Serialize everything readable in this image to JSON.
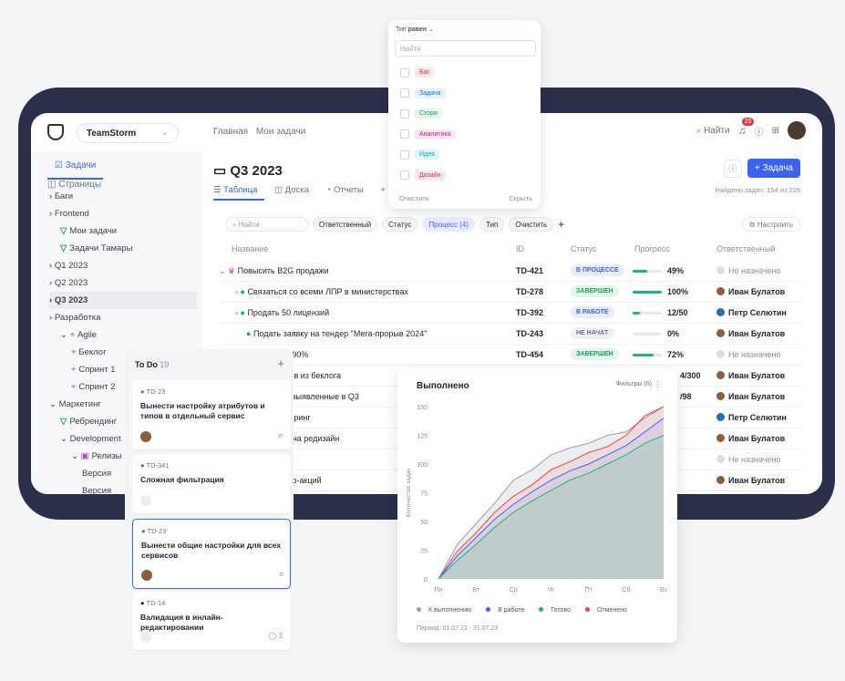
{
  "app": {
    "team": "TeamStorm",
    "nav": [
      "Главная",
      "Мои задачи"
    ],
    "search_label": "Найти",
    "notif_count": "25"
  },
  "sidebar": {
    "tabs": [
      "Задачи",
      "Страницы"
    ],
    "items": [
      {
        "label": "Баги",
        "indent": 0,
        "prefix": "›",
        "icon": ""
      },
      {
        "label": "Frontend",
        "indent": 0,
        "prefix": "›",
        "icon": ""
      },
      {
        "label": "Мои задачи",
        "indent": 1,
        "prefix": "",
        "icon": "g"
      },
      {
        "label": "Задачи Тамары",
        "indent": 1,
        "prefix": "",
        "icon": "g"
      },
      {
        "label": "Q1 2023",
        "indent": 0,
        "prefix": "›",
        "icon": ""
      },
      {
        "label": "Q2 2023",
        "indent": 0,
        "prefix": "›",
        "icon": ""
      },
      {
        "label": "Q3 2023",
        "indent": 0,
        "prefix": "›",
        "icon": "",
        "selected": true
      },
      {
        "label": "Разработка",
        "indent": 0,
        "prefix": "›",
        "icon": ""
      },
      {
        "label": "Agile",
        "indent": 1,
        "prefix": "⌄",
        "icon": "q"
      },
      {
        "label": "Беклог",
        "indent": 2,
        "prefix": "",
        "icon": "q"
      },
      {
        "label": "Спринт 1",
        "indent": 2,
        "prefix": "",
        "icon": "q"
      },
      {
        "label": "Спринт 2",
        "indent": 2,
        "prefix": "",
        "icon": "q"
      },
      {
        "label": "Маркетинг",
        "indent": 0,
        "prefix": "⌄",
        "icon": ""
      },
      {
        "label": "Ребрендинг",
        "indent": 1,
        "prefix": "",
        "icon": "g"
      },
      {
        "label": "Development",
        "indent": 1,
        "prefix": "⌄",
        "icon": ""
      },
      {
        "label": "Релизы",
        "indent": 2,
        "prefix": "⌄",
        "icon": "p"
      },
      {
        "label": "Версия",
        "indent": 3,
        "prefix": "",
        "icon": ""
      },
      {
        "label": "Версия",
        "indent": 3,
        "prefix": "",
        "icon": ""
      }
    ]
  },
  "page": {
    "title": "Q3 2023",
    "views": [
      "Таблица",
      "Доска",
      "Отчеты",
      "+"
    ],
    "add_task": "+ Задача",
    "found": "Найдено задач: 154 из 226"
  },
  "filters": {
    "search_placeholder": "Найти",
    "chips": [
      "Ответственный",
      "Статус",
      "Процесс (4)",
      "Тип"
    ],
    "clear": "Очистить",
    "configure": "Настроить"
  },
  "table": {
    "columns": [
      "Название",
      "ID",
      "Статус",
      "Прогресс",
      "Ответственный"
    ],
    "rows": [
      {
        "name": "Повысить B2G продажи",
        "level": 0,
        "id": "TD-421",
        "status": "В ПРОЦЕССЕ",
        "status_color": "#e7edff",
        "status_text": "#3b62f0",
        "progress": 0.49,
        "pct": "49%",
        "assignee": "Не назначено",
        "av": "#ddd"
      },
      {
        "name": "Связаться со всеми ЛПР в министерствах",
        "level": 1,
        "id": "TD-278",
        "status": "ЗАВЕРШЕН",
        "status_color": "#e2f6ea",
        "status_text": "#1f9d55",
        "progress": 1.0,
        "pct": "100%",
        "assignee": "Иван Булатов",
        "av": "#8b5e3c"
      },
      {
        "name": "Продать 50 лицензий",
        "level": 1,
        "id": "TD-392",
        "status": "В РАБОТЕ",
        "status_color": "#e7edff",
        "status_text": "#3b62f0",
        "progress": 0.24,
        "pct": "12/50",
        "assignee": "Петр Селютин",
        "av": "#2d6ea8"
      },
      {
        "name": "Подать заявку на тендер \"Мега-прорыв 2024\"",
        "level": 2,
        "id": "TD-243",
        "status": "НЕ НАЧАТ",
        "status_color": "#eef0f3",
        "status_text": "#6b7280",
        "progress": 0,
        "pct": "0%",
        "assignee": "Иван Булатов",
        "av": "#8b5e3c"
      },
      {
        "name": "…олог на 90%",
        "level": 2,
        "id": "TD-454",
        "status": "ЗАВЕРШЕН",
        "status_color": "#e2f6ea",
        "status_text": "#1f9d55",
        "progress": 0.72,
        "pct": "72%",
        "assignee": "Не назначено",
        "av": "#ddd"
      },
      {
        "name": "…300 багов из беклога",
        "level": 2,
        "id": "",
        "status": "",
        "progress": null,
        "pct": "4/300",
        "assignee": "Иван Булатов",
        "av": "#8b5e3c"
      },
      {
        "name": "…се баги выявленные в Q3",
        "level": 2,
        "id": "",
        "status": "",
        "progress": null,
        "pct": "/98",
        "assignee": "Иван Булатов",
        "av": "#8b5e3c"
      },
      {
        "name": "…рефакторинг",
        "level": 2,
        "id": "",
        "status": "",
        "progress": null,
        "pct": "",
        "assignee": "Петр Селютин",
        "av": "#2d6ea8"
      },
      {
        "name": "…0 задач на редизайн",
        "level": 2,
        "id": "",
        "status": "",
        "progress": null,
        "pct": "",
        "assignee": "Иван Булатов",
        "av": "#8b5e3c"
      },
      {
        "name": "…в 2 раза",
        "level": 2,
        "id": "",
        "status": "",
        "progress": null,
        "pct": "",
        "assignee": "Не назначено",
        "av": "#ddd"
      },
      {
        "name": "…10 промо-акций",
        "level": 2,
        "id": "",
        "status": "",
        "progress": null,
        "pct": "",
        "assignee": "Иван Булатов",
        "av": "#8b5e3c"
      }
    ]
  },
  "type_filter": {
    "header": "Тип",
    "header_value": "равен",
    "placeholder": "Найти",
    "options": [
      {
        "label": "Баг",
        "bg": "#fde7e7",
        "fg": "#d33"
      },
      {
        "label": "Задача",
        "bg": "#e3f2fd",
        "fg": "#1976d2"
      },
      {
        "label": "Стори",
        "bg": "#e2f6ea",
        "fg": "#1f9d55"
      },
      {
        "label": "Аналитика",
        "bg": "#fbe7f3",
        "fg": "#c0267a"
      },
      {
        "label": "Идея",
        "bg": "#e0f7f8",
        "fg": "#12a0a8"
      },
      {
        "label": "Дизайн",
        "bg": "#fde7ee",
        "fg": "#d32f6a"
      }
    ],
    "clear": "Очистить",
    "hide": "Скрыть"
  },
  "kanban": {
    "column": "To Do",
    "count": "19",
    "cards": [
      {
        "tag": "TD-23",
        "title": "Вынести настройку атрибутов и типов в отдельный сервис",
        "icon": "#8e4fd6",
        "selected": false,
        "extra": "📎"
      },
      {
        "tag": "TD-341",
        "title": "Сложная фильтрация",
        "icon": "#3b62f0",
        "selected": false,
        "extra": ""
      },
      {
        "tag": "TD-23",
        "title": "Вынести общие настройки для всех сервисов",
        "icon": "#3b62f0",
        "selected": true,
        "extra": "📎"
      },
      {
        "tag": "TD-14",
        "title": "Валидация в инлайн-редактировании",
        "icon": "#222",
        "selected": false,
        "extra": "◯ 3"
      }
    ]
  },
  "chart_data": {
    "type": "area",
    "title": "Выполнено",
    "filters_label": "Фильтры (6)",
    "ylabel": "Количество задач",
    "ylim": [
      0,
      150
    ],
    "yticks": [
      0,
      25,
      50,
      75,
      100,
      125,
      150
    ],
    "categories": [
      "Пн",
      "Вт",
      "Ср",
      "Чт",
      "Пт",
      "Сб",
      "Вс"
    ],
    "x": [
      0,
      0.5,
      1,
      1.5,
      2,
      2.5,
      3,
      3.5,
      4,
      4.5,
      5,
      5.5,
      6
    ],
    "series": [
      {
        "name": "К выполнению",
        "color": "#9aa0a6",
        "values": [
          0,
          30,
          48,
          66,
          86,
          95,
          108,
          114,
          118,
          125,
          128,
          140,
          150
        ]
      },
      {
        "name": "Отменено",
        "color": "#ef4444",
        "values": [
          0,
          24,
          40,
          58,
          72,
          82,
          95,
          102,
          110,
          115,
          125,
          142,
          150
        ]
      },
      {
        "name": "В работе",
        "color": "#3b62f0",
        "values": [
          0,
          20,
          36,
          52,
          65,
          76,
          86,
          94,
          100,
          108,
          116,
          128,
          140
        ]
      },
      {
        "name": "Готово",
        "color": "#22b573",
        "values": [
          0,
          16,
          30,
          45,
          58,
          68,
          77,
          86,
          92,
          100,
          108,
          118,
          125
        ]
      }
    ],
    "legend": [
      "К выполнению",
      "В работе",
      "Готово",
      "Отменено"
    ],
    "legend_colors": [
      "#9aa0a6",
      "#3b62f0",
      "#22b573",
      "#ef4444"
    ],
    "period": "Период: 01.07.23 - 31.07.23"
  }
}
